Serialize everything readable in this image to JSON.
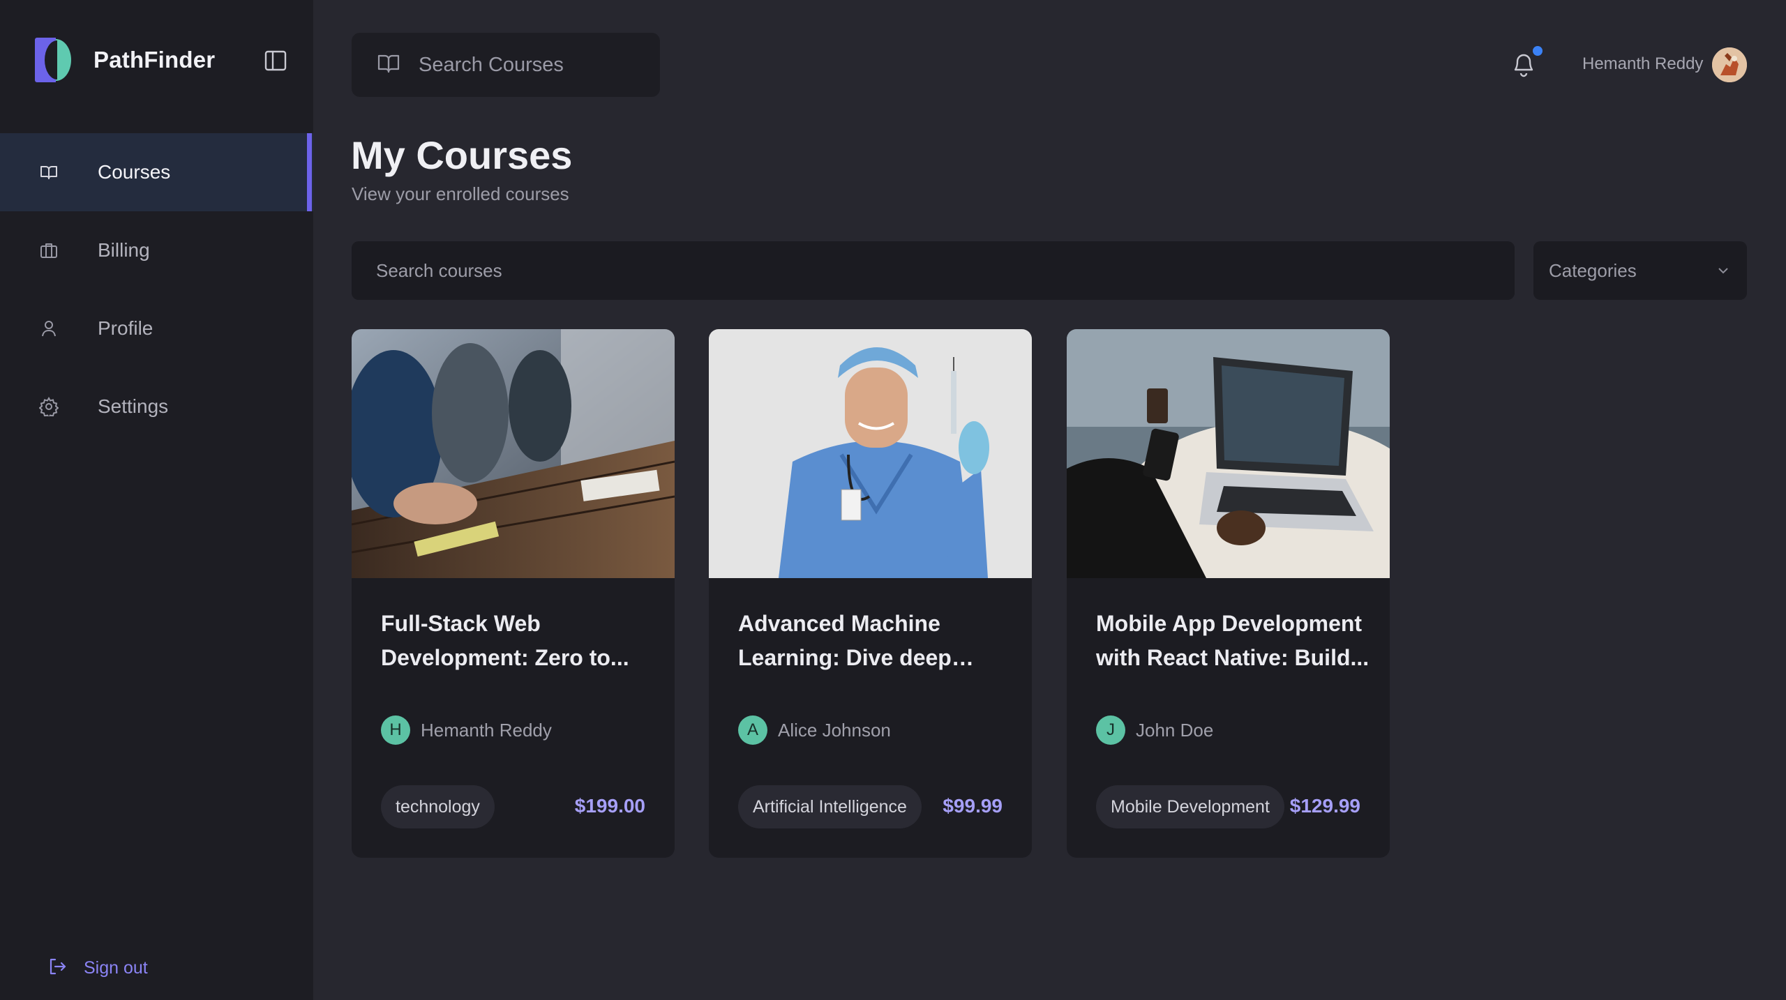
{
  "brand": {
    "name": "PathFinder"
  },
  "sidebar": {
    "items": [
      {
        "label": "Courses",
        "icon": "book-open-icon",
        "active": true
      },
      {
        "label": "Billing",
        "icon": "briefcase-icon",
        "active": false
      },
      {
        "label": "Profile",
        "icon": "user-icon",
        "active": false
      },
      {
        "label": "Settings",
        "icon": "gear-icon",
        "active": false
      }
    ],
    "signout_label": "Sign out"
  },
  "header": {
    "search_placeholder": "Search Courses",
    "user_name": "Hemanth Reddy",
    "has_notification": true
  },
  "main": {
    "title": "My Courses",
    "subtitle": "View your enrolled courses",
    "search_placeholder": "Search courses",
    "categories_label": "Categories"
  },
  "courses": [
    {
      "title": "Full-Stack Web Development: Zero to...",
      "author": "Hemanth Reddy",
      "author_initial": "H",
      "tag": "technology",
      "price": "$199.00",
      "image": "meeting-table-photo"
    },
    {
      "title": "Advanced Machine Learning: Dive deep into...",
      "author": "Alice Johnson",
      "author_initial": "A",
      "tag": "Artificial Intelligence",
      "price": "$99.99",
      "image": "doctor-syringe-photo"
    },
    {
      "title": "Mobile App Development with React Native: Build...",
      "author": "John Doe",
      "author_initial": "J",
      "tag": "Mobile Development",
      "price": "$129.99",
      "image": "laptop-phone-photo"
    }
  ],
  "colors": {
    "accent": "#6d63ea",
    "price": "#a69ff7",
    "avatar_initial_bg": "#5cc2a4",
    "notification_dot": "#3b82f6"
  }
}
